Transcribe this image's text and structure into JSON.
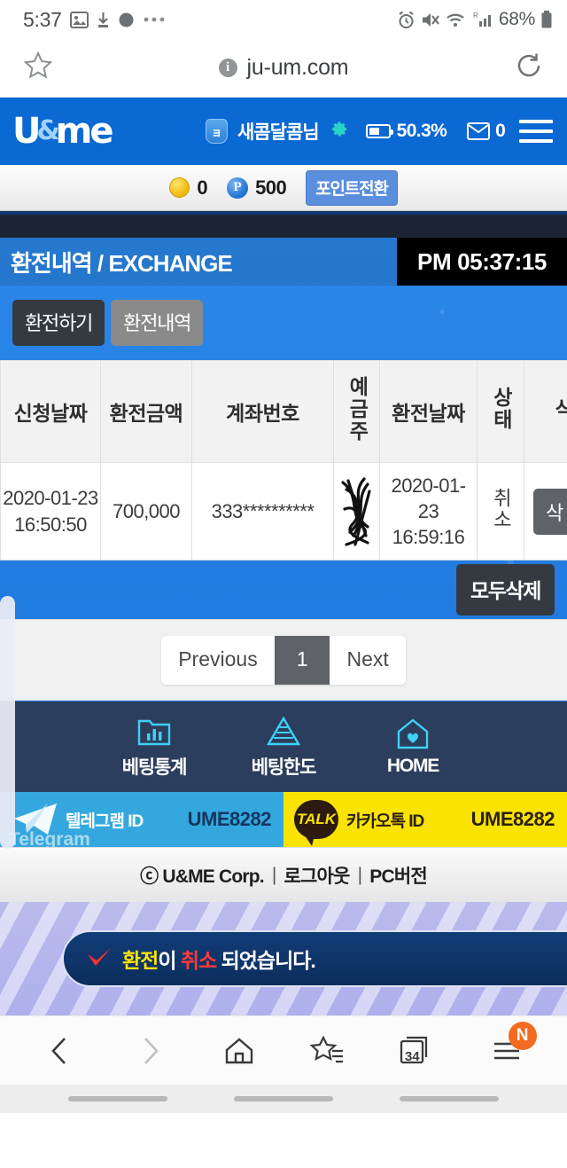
{
  "status_bar": {
    "time": "5:37",
    "battery_pct": "68%",
    "icons": [
      "image-icon",
      "download-icon",
      "dot-icon",
      "more-icon",
      "alarm-icon",
      "mute-icon",
      "wifi-icon",
      "signal-icon",
      "battery-icon"
    ]
  },
  "url_bar": {
    "url": "ju-um.com",
    "star_icon": "bookmark-star-icon",
    "reload_icon": "reload-icon",
    "info_icon": "info-icon"
  },
  "site_header": {
    "logo_u": "U",
    "logo_amp": "&",
    "logo_me": "me",
    "user_badge": "ョ",
    "user_name": "새콤달콤님",
    "gear_icon": "gear-icon",
    "battery_label": "50.3%",
    "mail_count": "0",
    "menu_icon": "hamburger-menu-icon"
  },
  "point_bar": {
    "coin_value": "0",
    "point_symbol": "P",
    "point_value": "500",
    "convert_button": "포인트전환"
  },
  "page": {
    "title": "환전내역 / EXCHANGE",
    "clock": "PM 05:37:15",
    "tabs": [
      {
        "label": "환전하기",
        "active": true
      },
      {
        "label": "환전내역",
        "active": false
      }
    ]
  },
  "table": {
    "headers": {
      "request_date": "신청날짜",
      "amount": "환전금액",
      "account_no": "계좌번호",
      "depositor": "예금주",
      "exchange_date": "환전날짜",
      "status": "상태",
      "delete": "삭"
    },
    "rows": [
      {
        "request_date": "2020-01-23 16:50:50",
        "amount": "700,000",
        "account_no": "333**********",
        "depositor": "",
        "exchange_date": "2020-01-23 16:59:16",
        "status": "취소",
        "delete_label": "삭"
      }
    ]
  },
  "actions": {
    "delete_all": "모두삭제"
  },
  "pagination": {
    "previous": "Previous",
    "current": "1",
    "next": "Next"
  },
  "site_nav": [
    {
      "label": "베팅통계",
      "icon": "folder-chart-icon"
    },
    {
      "label": "베팅한도",
      "icon": "pyramid-icon"
    },
    {
      "label": "HOME",
      "icon": "home-heart-icon"
    }
  ],
  "messengers": {
    "telegram": {
      "label": "텔레그램 ID",
      "sub": "Telegram",
      "id": "UME8282",
      "icon": "telegram-plane-icon"
    },
    "kakao": {
      "label": "카카오톡 ID",
      "bubble": "TALK",
      "id": "UME8282",
      "icon": "kakao-talk-icon"
    }
  },
  "footer": {
    "copyright": "ⓒ U&ME Corp.",
    "sep1": "|",
    "logout": "로그아웃",
    "sep2": "|",
    "pc_version": "PC버전"
  },
  "toast": {
    "check_icon": "red-check-icon",
    "part_yellow": "환전",
    "part_white_1": "이 ",
    "part_red": "취소",
    "part_white_2": " 되었습니다."
  },
  "browser_nav": {
    "back": "back-icon",
    "forward": "forward-icon",
    "home": "home-icon",
    "bookmarks": "bookmarks-icon",
    "tabs_count": "34",
    "menu": "menu-icon",
    "menu_badge": "N"
  },
  "colors": {
    "brand_blue": "#0b69d4",
    "page_blue": "#2b87e8",
    "dark_navy": "#1b2533",
    "tab_active": "#343a40",
    "tab_inactive": "#8a8a8a",
    "nav_bg": "#2c3e5d",
    "telegram": "#34a8de",
    "kakao": "#fae300",
    "toast_bg": "#123d78",
    "badge_orange": "#f26b21"
  }
}
